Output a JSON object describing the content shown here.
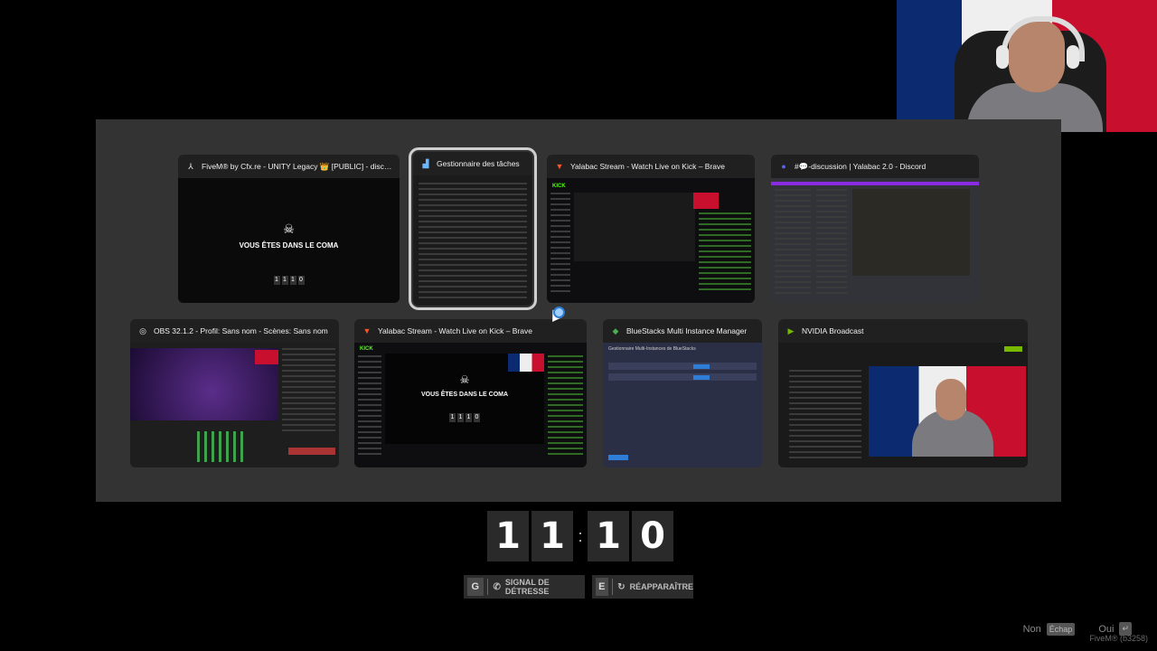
{
  "windows": [
    {
      "title": "FiveM® by Cfx.re - UNITY Legacy 👑 [PUBLIC] - discord.g...",
      "icon": "⅄",
      "icon_name": "fivem-icon",
      "thumb": "coma"
    },
    {
      "title": "Gestionnaire des tâches",
      "icon": "▟",
      "icon_name": "task-manager-icon",
      "thumb": "taskmgr"
    },
    {
      "title": "Yalabac Stream - Watch Live on Kick – Brave",
      "icon": "▼",
      "icon_name": "brave-icon",
      "thumb": "kick"
    },
    {
      "title": "#💬-discussion | Yalabac 2.0 - Discord",
      "icon": "●",
      "icon_name": "discord-icon",
      "thumb": "discord"
    },
    {
      "title": "OBS 32.1.2 - Profil: Sans nom - Scènes: Sans nom",
      "icon": "◎",
      "icon_name": "obs-icon",
      "thumb": "obs"
    },
    {
      "title": "Yalabac Stream - Watch Live on Kick – Brave",
      "icon": "▼",
      "icon_name": "brave-icon",
      "thumb": "kick2"
    },
    {
      "title": "BlueStacks Multi Instance Manager",
      "icon": "◆",
      "icon_name": "bluestacks-icon",
      "thumb": "bluestacks"
    },
    {
      "title": "NVIDIA Broadcast",
      "icon": "▶",
      "icon_name": "nvidia-icon",
      "thumb": "nvidia"
    }
  ],
  "game_overlay": {
    "coma_text": "VOUS ÊTES DANS LE COMA",
    "logo": "quasen",
    "bluestacks_title": "Gestionnaire Multi-Instances de BlueStacks",
    "kick_logo": "KICK"
  },
  "timer": {
    "d1": "1",
    "d2": "1",
    "colon": ":",
    "d3": "1",
    "d4": "0"
  },
  "hints": {
    "distress_key": "G",
    "distress_label": "SIGNAL DE DÉTRESSE",
    "respawn_key": "E",
    "respawn_label": "RÉAPPARAÎTRE"
  },
  "prompt": {
    "no_label": "Non",
    "no_key": "Échap",
    "yes_label": "Oui",
    "yes_key": "↵"
  },
  "version": "FiveM® (b3258)",
  "colors": {
    "accent_red": "#c8102e",
    "accent_blue": "#0b2a6f",
    "kick_green": "#53fc18",
    "discord_purple": "#8a2be2"
  }
}
